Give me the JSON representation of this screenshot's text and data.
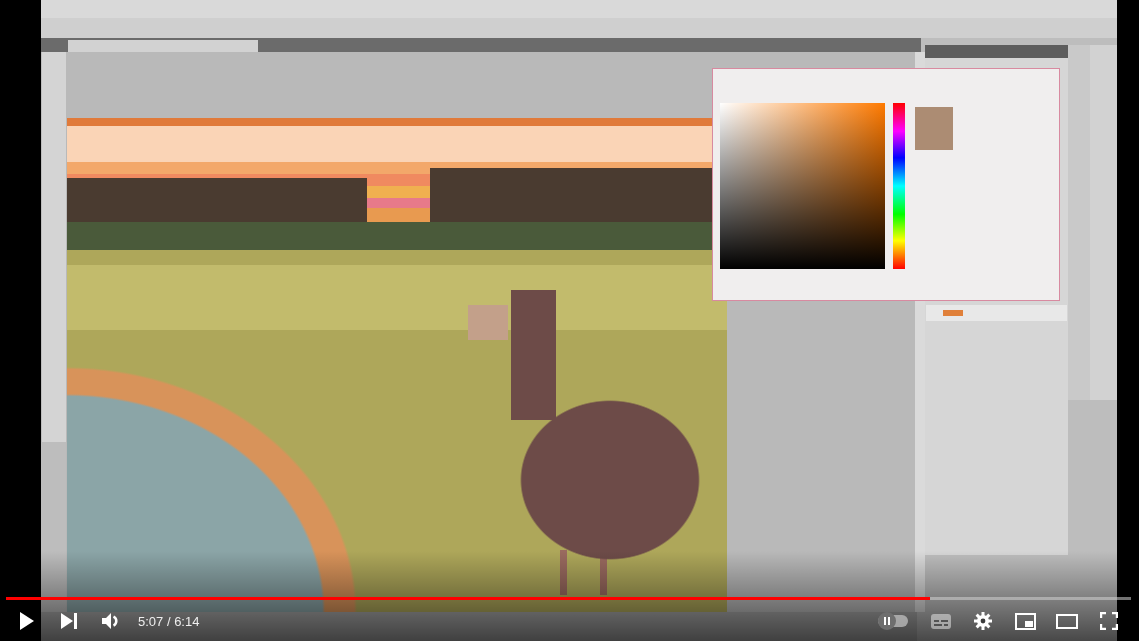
{
  "player": {
    "paused": true,
    "progress": {
      "level": 0.821
    },
    "muted": false,
    "time": "5:07 / 6:14",
    "autoplay": {
      "on": false
    },
    "captions": {
      "disabled": true
    }
  }
}
